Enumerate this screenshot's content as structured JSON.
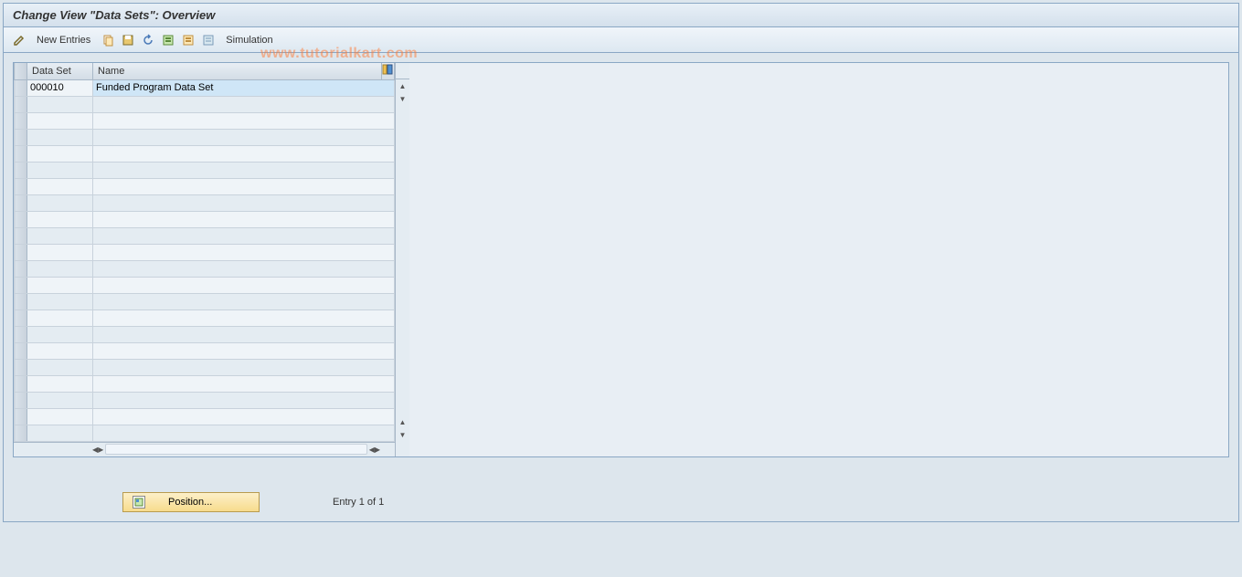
{
  "title": "Change View \"Data Sets\": Overview",
  "toolbar": {
    "new_entries_label": "New Entries",
    "simulation_label": "Simulation"
  },
  "table": {
    "columns": {
      "data_set": "Data Set",
      "name": "Name"
    },
    "rows": [
      {
        "data_set": "000010",
        "name": "Funded Program Data Set"
      }
    ],
    "empty_row_count": 21
  },
  "footer": {
    "position_label": "Position...",
    "entry_text": "Entry 1 of 1"
  },
  "watermark": "www.tutorialkart.com"
}
